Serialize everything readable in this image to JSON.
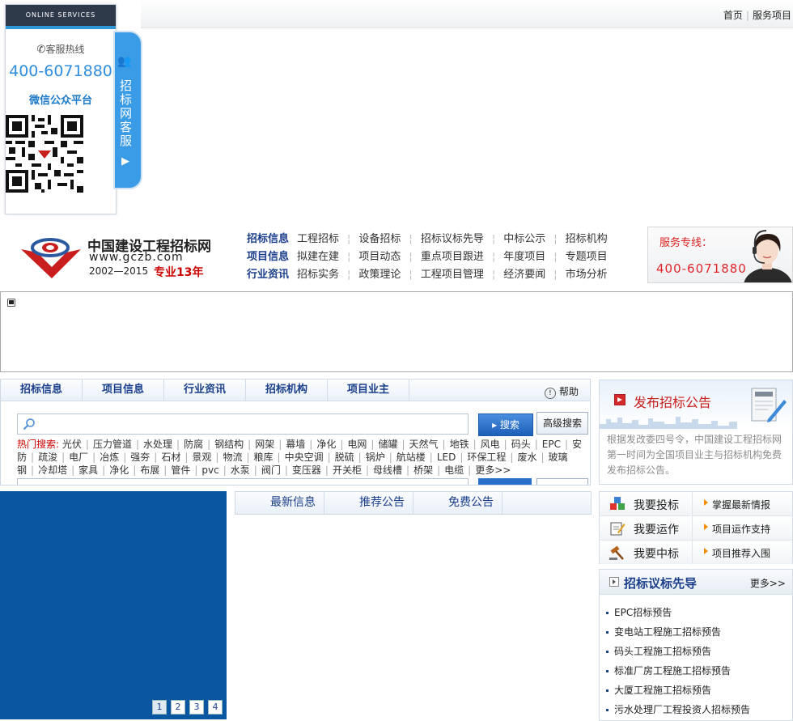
{
  "float_panel": {
    "header": "ONLINE SERVICES",
    "hotline_label": "客服热线",
    "hotline": "400-6071880",
    "wechat_label": "微信公众平台",
    "tab_text": "招标网客服"
  },
  "top_links": [
    "首页",
    "服务项目"
  ],
  "logo": {
    "name": "中国建设工程招标网",
    "url": "www.gczb.com",
    "years": "2002—2015",
    "slogan": "专业13年"
  },
  "main_nav": [
    {
      "category": "招标信息",
      "links": [
        "工程招标",
        "设备招标",
        "招标议标先导",
        "中标公示",
        "招标机构"
      ]
    },
    {
      "category": "项目信息",
      "links": [
        "拟建在建",
        "项目动态",
        "重点项目跟进",
        "年度项目",
        "专题项目"
      ]
    },
    {
      "category": "行业资讯",
      "links": [
        "招标实务",
        "政策理论",
        "工程项目管理",
        "经济要闻",
        "市场分析"
      ]
    }
  ],
  "service_hotline": {
    "label": "服务专线：",
    "number": "400-6071880"
  },
  "search": {
    "tabs": [
      "招标信息",
      "项目信息",
      "行业资讯",
      "招标机构",
      "项目业主"
    ],
    "help_label": "帮助",
    "placeholder": "",
    "search_button": "搜索",
    "advanced_button": "高级搜索",
    "hot_label": "热门搜索:",
    "hot_terms": [
      "光伏",
      "压力管道",
      "水处理",
      "防腐",
      "钢结构",
      "网架",
      "幕墙",
      "净化",
      "电网",
      "储罐",
      "天然气",
      "地铁",
      "风电",
      "码头",
      "EPC",
      "安防",
      "疏浚",
      "电厂",
      "冶炼",
      "强夯",
      "石材",
      "景观",
      "物流",
      "粮库",
      "中央空调",
      "脱硫",
      "锅炉",
      "航站楼",
      "LED",
      "环保工程",
      "废水",
      "玻璃钢",
      "冷却塔",
      "家具",
      "净化",
      "布展",
      "管件",
      "pvc",
      "水泵",
      "阀门",
      "变压器",
      "开关柜",
      "母线槽",
      "桥架",
      "电缆"
    ],
    "hot_more": "更多>>"
  },
  "publish": {
    "title": "发布招标公告",
    "description": "根据发改委四号令，中国建设工程招标网第一时间为全国项目业主与招标机构免费发布招标公告。"
  },
  "slider": {
    "pages": [
      "1",
      "2",
      "3",
      "4"
    ]
  },
  "center_tabs": [
    "最新信息",
    "推荐公告",
    "免费公告"
  ],
  "actions": [
    {
      "label": "我要投标",
      "desc": "掌握最新情报"
    },
    {
      "label": "我要运作",
      "desc": "项目运作支持"
    },
    {
      "label": "我要中标",
      "desc": "项目推荐入围"
    }
  ],
  "forecast": {
    "title": "招标议标先导",
    "more": "更多>>",
    "items": [
      "EPC招标预告",
      "变电站工程施工招标预告",
      "码头工程施工招标预告",
      "标准厂房工程施工招标预告",
      "大厦工程施工招标预告",
      "污水处理厂工程投资人招标预告"
    ]
  },
  "colors": {
    "brand_blue": "#1b3e8b",
    "accent_red": "#c81e1e",
    "hotline_blue": "#2f8ee0",
    "slider_blue": "#0a56a0"
  }
}
